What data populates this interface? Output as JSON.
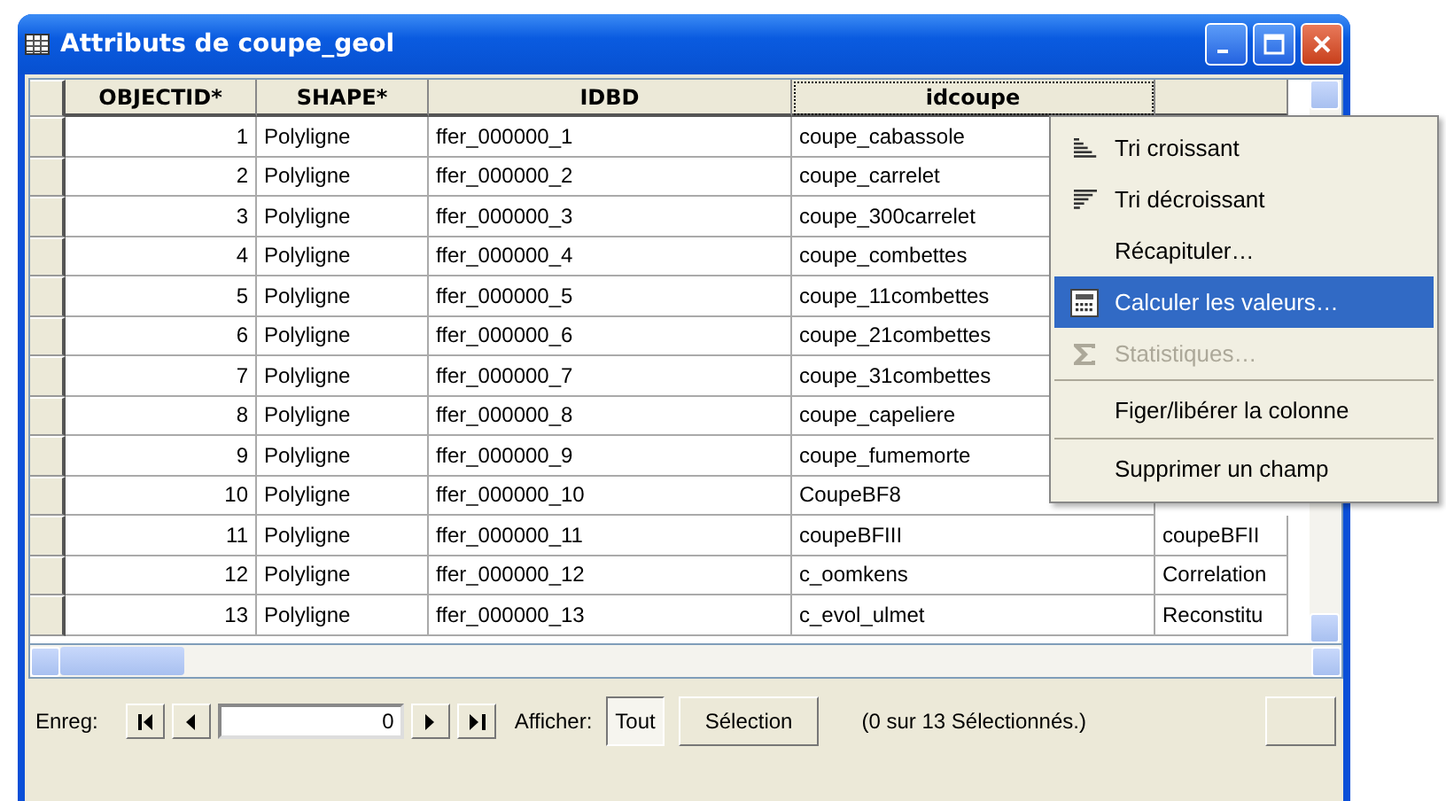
{
  "window": {
    "title": "Attributs de coupe_geol"
  },
  "table": {
    "columns": [
      {
        "label": "OBJECTID*",
        "kind": "number",
        "selected": false
      },
      {
        "label": "SHAPE*",
        "kind": "text",
        "selected": false
      },
      {
        "label": "IDBD",
        "kind": "text",
        "selected": false
      },
      {
        "label": "idcoupe",
        "kind": "text",
        "selected": true
      },
      {
        "kind": "text",
        "selected": false
      }
    ],
    "rows": [
      {
        "cells": [
          "1",
          "Polyligne",
          "ffer_000000_1",
          "coupe_cabassole"
        ]
      },
      {
        "cells": [
          "2",
          "Polyligne",
          "ffer_000000_2",
          "coupe_carrelet"
        ]
      },
      {
        "cells": [
          "3",
          "Polyligne",
          "ffer_000000_3",
          "coupe_300carrelet"
        ]
      },
      {
        "cells": [
          "4",
          "Polyligne",
          "ffer_000000_4",
          "coupe_combettes"
        ]
      },
      {
        "cells": [
          "5",
          "Polyligne",
          "ffer_000000_5",
          "coupe_11combettes"
        ]
      },
      {
        "cells": [
          "6",
          "Polyligne",
          "ffer_000000_6",
          "coupe_21combettes"
        ]
      },
      {
        "cells": [
          "7",
          "Polyligne",
          "ffer_000000_7",
          "coupe_31combettes"
        ]
      },
      {
        "cells": [
          "8",
          "Polyligne",
          "ffer_000000_8",
          "coupe_capeliere"
        ]
      },
      {
        "cells": [
          "9",
          "Polyligne",
          "ffer_000000_9",
          "coupe_fumemorte"
        ]
      },
      {
        "cells": [
          "10",
          "Polyligne",
          "ffer_000000_10",
          "CoupeBF8"
        ]
      },
      {
        "cells": [
          "11",
          "Polyligne",
          "ffer_000000_11",
          "coupeBFIII",
          "coupeBFII"
        ]
      },
      {
        "cells": [
          "12",
          "Polyligne",
          "ffer_000000_12",
          "c_oomkens",
          "Correlation"
        ]
      },
      {
        "cells": [
          "13",
          "Polyligne",
          "ffer_000000_13",
          "c_evol_ulmet",
          "Reconstitu"
        ]
      }
    ]
  },
  "context_menu": {
    "items": [
      {
        "label": "Tri croissant",
        "kind": "sort-up",
        "selected": false,
        "disabled": false,
        "divider_above": false
      },
      {
        "label": "Tri décroissant",
        "kind": "sort-down",
        "selected": false,
        "disabled": false,
        "divider_above": false
      },
      {
        "label": "Récapituler…",
        "kind": "plain",
        "selected": false,
        "disabled": false,
        "divider_above": false
      },
      {
        "label": "Calculer les valeurs…",
        "kind": "calculator",
        "selected": true,
        "disabled": false,
        "divider_above": false
      },
      {
        "label": "Statistiques…",
        "kind": "sigma",
        "selected": false,
        "disabled": true,
        "divider_above": false
      },
      {
        "label": "Figer/libérer la colonne",
        "kind": "plain",
        "selected": false,
        "disabled": false,
        "divider_above": true
      },
      {
        "label": "Supprimer un champ",
        "kind": "plain",
        "selected": false,
        "disabled": false,
        "divider_above": true
      }
    ]
  },
  "navigator": {
    "record_label": "Enreg:",
    "record_value": "0",
    "show_label": "Afficher:",
    "show_buttons": [
      {
        "label": "Tout",
        "selected": true
      },
      {
        "label": "Sélection",
        "selected": false
      }
    ],
    "status": "(0 sur 13 Sélectionnés.)"
  }
}
